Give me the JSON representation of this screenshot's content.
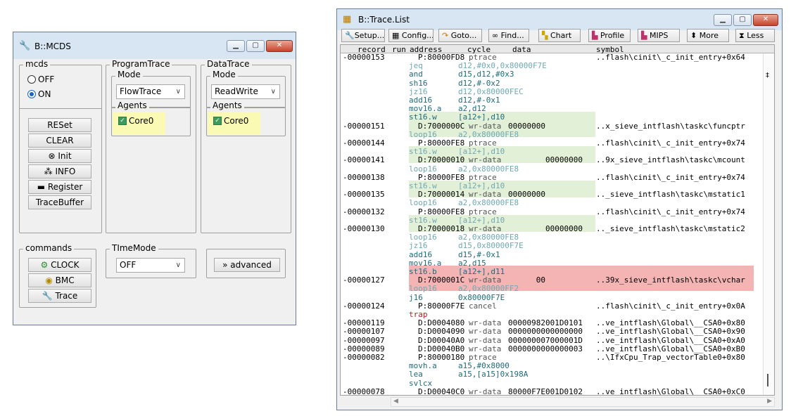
{
  "mcds_window": {
    "title": "B::MCDS",
    "mcds_group": {
      "legend": "mcds",
      "off_label": "OFF",
      "on_label": "ON",
      "selected": "ON"
    },
    "buttons": [
      "RESet",
      "CLEAR",
      "Init",
      "INFO",
      "Register",
      "TraceBuffer"
    ],
    "program_trace": {
      "legend": "ProgramTrace",
      "mode_legend": "Mode",
      "mode_value": "FlowTrace",
      "agents_legend": "Agents",
      "agent": "Core0"
    },
    "data_trace": {
      "legend": "DataTrace",
      "mode_legend": "Mode",
      "mode_value": "ReadWrite",
      "agents_legend": "Agents",
      "agent": "Core0"
    },
    "commands": {
      "legend": "commands",
      "buttons": [
        "CLOCK",
        "BMC",
        "Trace"
      ]
    },
    "time_mode": {
      "legend": "TImeMode",
      "value": "OFF"
    },
    "advanced_label": "advanced"
  },
  "trace_window": {
    "title": "B::Trace.List",
    "toolbar": [
      "Setup...",
      "Config...",
      "Goto...",
      "Find...",
      "Chart",
      "Profile",
      "MIPS",
      "More",
      "Less"
    ],
    "columns": {
      "record": "record",
      "run": "run",
      "address": "address",
      "cycle": "cycle",
      "data": "data",
      "symbol": "symbol"
    },
    "rows": [
      {
        "rec": "-00000153",
        "addr": "P:80000FD8",
        "cyc": "ptrace",
        "data": "",
        "sym": "..flash\\cinit\\_c_init_entry+0x64",
        "kind": "rec"
      },
      {
        "mn": "jeq",
        "ops": "d12,#0x0,0x80000F7E",
        "kind": "dim"
      },
      {
        "mn": "and",
        "ops": "d15,d12,#0x3",
        "kind": "dark"
      },
      {
        "mn": "sh16",
        "ops": "d12,#-0x2",
        "kind": "dark"
      },
      {
        "mn": "jz16",
        "ops": "d12,0x80000FEC",
        "kind": "dim"
      },
      {
        "mn": "add16",
        "ops": "d12,#-0x1",
        "kind": "dark"
      },
      {
        "mn": "mov16.a",
        "ops": "a2,d12",
        "kind": "dark"
      },
      {
        "mn": "st16.w",
        "ops": "[a12+],d10",
        "kind": "dark"
      },
      {
        "rec": "-00000151",
        "addr": "D:7000000C",
        "cyc": "wr-data",
        "data": "00000000",
        "sym": "..x_sieve_intflash\\taskc\\funcptr",
        "kind": "rec"
      },
      {
        "mn": "loop16",
        "ops": "a2,0x80000FE8",
        "kind": "dim"
      },
      {
        "rec": "-00000144",
        "addr": "P:80000FE8",
        "cyc": "ptrace",
        "data": "",
        "sym": "..flash\\cinit\\_c_init_entry+0x74",
        "kind": "rec"
      },
      {
        "mn": "st16.w",
        "ops": "[a12+],d10",
        "kind": "dim"
      },
      {
        "rec": "-00000141",
        "addr": "D:70000010",
        "cyc": "wr-data",
        "data": "        00000000",
        "sym": "..9x_sieve_intflash\\taskc\\mcount",
        "kind": "rec"
      },
      {
        "mn": "loop16",
        "ops": "a2,0x80000FE8",
        "kind": "dim"
      },
      {
        "rec": "-00000138",
        "addr": "P:80000FE8",
        "cyc": "ptrace",
        "data": "",
        "sym": "..flash\\cinit\\_c_init_entry+0x74",
        "kind": "rec"
      },
      {
        "mn": "st16.w",
        "ops": "[a12+],d10",
        "kind": "dim"
      },
      {
        "rec": "-00000135",
        "addr": "D:70000014",
        "cyc": "wr-data",
        "data": "00000000",
        "sym": ".._sieve_intflash\\taskc\\mstatic1",
        "kind": "rec"
      },
      {
        "mn": "loop16",
        "ops": "a2,0x80000FE8",
        "kind": "dim"
      },
      {
        "rec": "-00000132",
        "addr": "P:80000FE8",
        "cyc": "ptrace",
        "data": "",
        "sym": "..flash\\cinit\\_c_init_entry+0x74",
        "kind": "rec"
      },
      {
        "mn": "st16.w",
        "ops": "[a12+],d10",
        "kind": "dim"
      },
      {
        "rec": "-00000130",
        "addr": "D:70000018",
        "cyc": "wr-data",
        "data": "        00000000",
        "sym": ".._sieve_intflash\\taskc\\mstatic2",
        "kind": "rec"
      },
      {
        "mn": "loop16",
        "ops": "a2,0x80000FE8",
        "kind": "dim"
      },
      {
        "mn": "jz16",
        "ops": "d15,0x80000F7E",
        "kind": "dim"
      },
      {
        "mn": "add16",
        "ops": "d15,#-0x1",
        "kind": "dark"
      },
      {
        "mn": "mov16.a",
        "ops": "a2,d15",
        "kind": "dark"
      },
      {
        "mn": "st16.b",
        "ops": "[a12+],d11",
        "kind": "dark"
      },
      {
        "rec": "-00000127",
        "addr": "D:7000001C",
        "cyc": "wr-data",
        "data": "      00",
        "sym": "..39x_sieve_intflash\\taskc\\vchar",
        "kind": "rec"
      },
      {
        "mn": "loop16",
        "ops": "a2,0x80000FF2",
        "kind": "dim"
      },
      {
        "mn": "j16",
        "ops": "0x80000F7E",
        "kind": "dark"
      },
      {
        "rec": "-00000124",
        "addr": "P:80000F7E",
        "cyc": "cancel",
        "data": "",
        "sym": "..flash\\cinit\\_c_init_entry+0x0A",
        "kind": "rec"
      },
      {
        "mn": "trap",
        "ops": "",
        "kind": "trap"
      },
      {
        "rec": "-00000119",
        "addr": "D:D0004080",
        "cyc": "wr-data",
        "data": "00000982001D0101",
        "sym": "..ve_intflash\\Global\\__CSA0+0x80",
        "kind": "rec"
      },
      {
        "rec": "-00000107",
        "addr": "D:D0004090",
        "cyc": "wr-data",
        "data": "0000000000000000",
        "sym": "..ve_intflash\\Global\\__CSA0+0x90",
        "kind": "rec"
      },
      {
        "rec": "-00000097",
        "addr": "D:D00040A0",
        "cyc": "wr-data",
        "data": "000000007000001D",
        "sym": "..ve_intflash\\Global\\__CSA0+0xA0",
        "kind": "rec"
      },
      {
        "rec": "-00000089",
        "addr": "D:D00040B0",
        "cyc": "wr-data",
        "data": "0000000000000003",
        "sym": "..ve_intflash\\Global\\__CSA0+0xB0",
        "kind": "rec"
      },
      {
        "rec": "-00000082",
        "addr": "P:80000180",
        "cyc": "ptrace",
        "data": "",
        "sym": "..\\IfxCpu_Trap_vectorTable0+0x80",
        "kind": "rec"
      },
      {
        "mn": "movh.a",
        "ops": "a15,#0x8000",
        "kind": "dark"
      },
      {
        "mn": "lea",
        "ops": "a15,[a15]0x198A",
        "kind": "dark"
      },
      {
        "mn": "svlcx",
        "ops": "",
        "kind": "dark"
      },
      {
        "rec": "-00000078",
        "addr": "D:D00040C0",
        "cyc": "wr-data",
        "data": "80000F7E001D0102",
        "sym": "..ve_intflash\\Global\\__CSA0+0xC0",
        "kind": "rec"
      }
    ]
  }
}
